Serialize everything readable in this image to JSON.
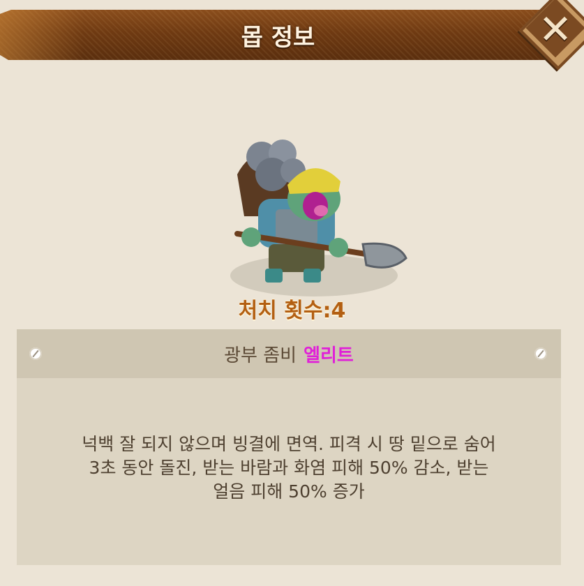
{
  "header": {
    "title": "몹 정보"
  },
  "close_button": {
    "label": "✕"
  },
  "monster": {
    "kill_count_label": "처치 횟수:4",
    "name": "광부 좀비",
    "grade": "엘리트",
    "description": "넉백 잘 되지 않으며 빙결에 면역. 피격 시 땅 밑으로 숨어\n3초 동안 돌진, 받는 바람과 화염 피해 50% 감소, 받는\n얼음 피해 50% 증가"
  },
  "colors": {
    "banner": "#6f3a12",
    "kill_count": "#b35f12",
    "elite": "#e020d8",
    "background": "#ece4d6"
  }
}
